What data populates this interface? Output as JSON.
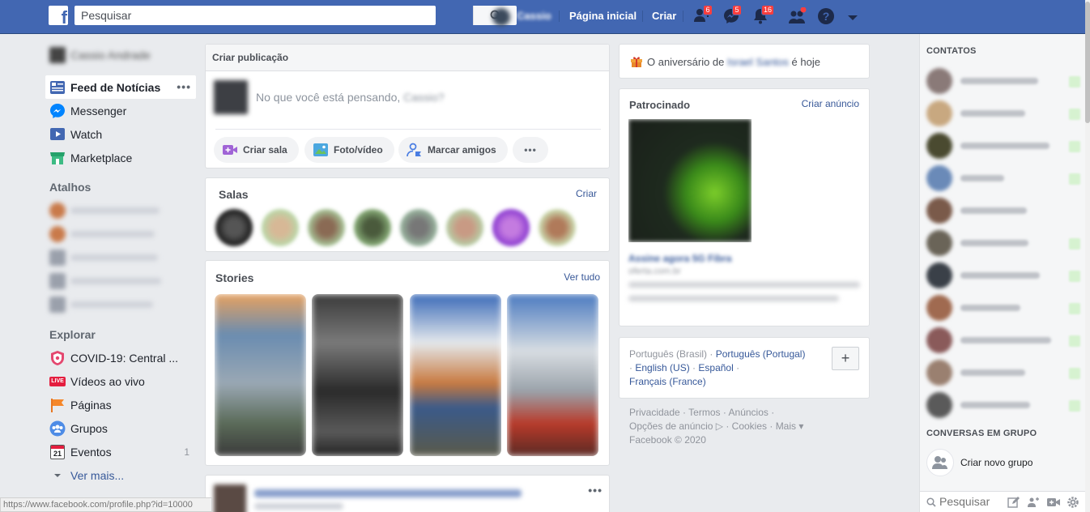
{
  "topbar": {
    "logo": "f",
    "search_placeholder": "Pesquisar",
    "user_name": "Cassio",
    "nav_home": "Página inicial",
    "nav_create": "Criar",
    "friend_requests_badge": "6",
    "messages_badge": "5",
    "notifications_badge": "16",
    "accent_color": "#4267b2"
  },
  "leftnav": {
    "profile_name": "Cassio Andrade",
    "items": [
      {
        "label": "Feed de Notícias",
        "icon": "news-feed-icon",
        "active": true
      },
      {
        "label": "Messenger",
        "icon": "messenger-icon"
      },
      {
        "label": "Watch",
        "icon": "watch-icon"
      },
      {
        "label": "Marketplace",
        "icon": "marketplace-icon"
      }
    ],
    "shortcuts_title": "Atalhos",
    "explore_title": "Explorar",
    "explore": [
      {
        "label": "COVID-19: Central ...",
        "icon": "covid-shield-icon"
      },
      {
        "label": "Vídeos ao vivo",
        "icon": "live-video-icon"
      },
      {
        "label": "Páginas",
        "icon": "pages-flag-icon"
      },
      {
        "label": "Grupos",
        "icon": "groups-icon"
      },
      {
        "label": "Eventos",
        "icon": "events-calendar-icon",
        "count": "1"
      }
    ],
    "see_more": "Ver mais...",
    "live_badge": "LIVE",
    "events_day": "21"
  },
  "composer": {
    "title": "Criar publicação",
    "prompt": "No que você está pensando,",
    "prompt_name": "Cassio?",
    "actions": [
      "Criar sala",
      "Foto/vídeo",
      "Marcar amigos"
    ]
  },
  "salas": {
    "title": "Salas",
    "link": "Criar"
  },
  "stories": {
    "title": "Stories",
    "link": "Ver tudo"
  },
  "birthday": {
    "prefix": "O aniversário de",
    "name": "Israel Santos",
    "suffix": "é hoje"
  },
  "sponsored": {
    "title": "Patrocinado",
    "link": "Criar anúncio",
    "ad_title": "Assine agora 5G Fibra",
    "ad_domain": "oferta.com.br"
  },
  "languages": {
    "current": "Português (Brasil)",
    "others": [
      "Português (Portugal)",
      "English (US)",
      "Español",
      "Français (France)"
    ],
    "add": "+"
  },
  "footer": {
    "links": [
      "Privacidade",
      "Termos",
      "Anúncios",
      "Opções de anúncio",
      "Cookies",
      "Mais"
    ],
    "copyright": "Facebook © 2020"
  },
  "chat": {
    "contacts_title": "CONTATOS",
    "groups_title": "CONVERSAS EM GRUPO",
    "new_group": "Criar novo grupo",
    "search_placeholder": "Pesquisar"
  },
  "status_url": "https://www.facebook.com/profile.php?id=10000"
}
